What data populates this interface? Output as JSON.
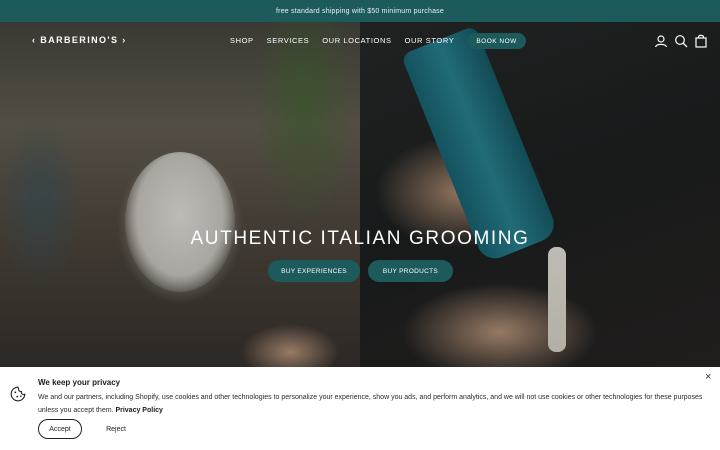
{
  "announcement": {
    "text": "free standard shipping with $50 minimum purchase"
  },
  "header": {
    "logo": "‹ BARBERINO'S ›",
    "nav": [
      "SHOP",
      "SERVICES",
      "OUR LOCATIONS",
      "OUR STORY"
    ],
    "book_label": "BOOK NOW",
    "icons": [
      "account-icon",
      "search-icon",
      "cart-icon"
    ]
  },
  "hero": {
    "headline": "AUTHENTIC ITALIAN GROOMING",
    "cta_experiences": "BUY EXPERIENCES",
    "cta_products": "BUY PRODUCTS"
  },
  "cookie": {
    "title": "We keep your privacy",
    "body": "We and our partners, including Shopify, use cookies and other technologies to personalize your experience, show you ads, and perform analytics, and we will not use cookies or other technologies for these purposes unless you accept them.",
    "link": "Privacy Policy",
    "accept_label": "Accept",
    "reject_label": "Reject",
    "close_symbol": "×"
  },
  "colors": {
    "brand_teal": "#1d5a5c",
    "banner_bg": "#ffffff"
  }
}
